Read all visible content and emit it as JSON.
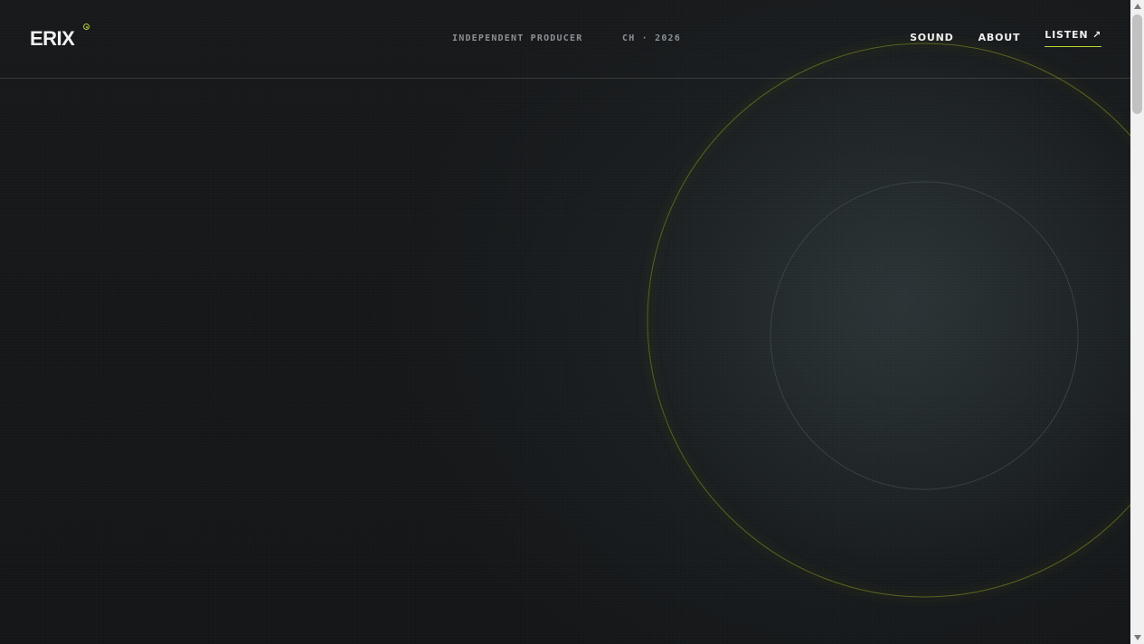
{
  "header": {
    "logo": "ERIX",
    "tagline": "INDEPENDENT PRODUCER",
    "location_year": "CH · 2026"
  },
  "nav": {
    "items": [
      {
        "label": "SOUND"
      },
      {
        "label": "ABOUT"
      },
      {
        "label": "LISTEN ↗"
      }
    ]
  },
  "colors": {
    "accent": "#b4d62a",
    "background": "#141618",
    "text": "#f0f0f0",
    "muted": "#8c9094"
  }
}
